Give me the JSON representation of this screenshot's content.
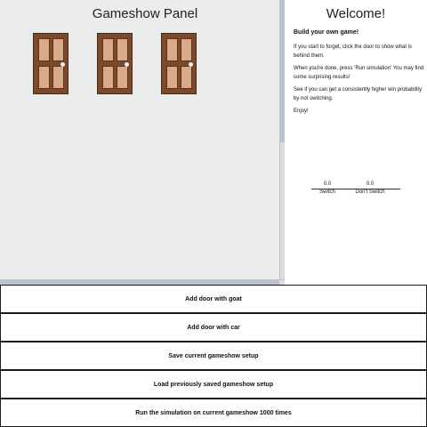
{
  "gameshow": {
    "title": "Gameshow Panel",
    "doors": [
      {
        "name": "door-1"
      },
      {
        "name": "door-2"
      },
      {
        "name": "door-3"
      }
    ]
  },
  "info": {
    "title": "Welcome!",
    "subtitle": "Build your own game!",
    "paragraphs": [
      "If you start to forget, click the door to show what is behind them.",
      "When you're done, press 'Run simulation' You may find some surprising results!",
      "See if you can get a consistently higher win probability by not switching.",
      "Enjoy!"
    ]
  },
  "stats": {
    "switch_value": "0.0",
    "noswitch_value": "0.0",
    "switch_label": "Switch",
    "noswitch_label": "Don't Switch"
  },
  "buttons": {
    "add_goat": "Add door with goat",
    "add_car": "Add door with car",
    "save": "Save current gameshow setup",
    "load": "Load previously saved gameshow setup",
    "run": "Run the simulation on current gameshow 1000 times"
  },
  "colors": {
    "door_frame": "#7a4a2a",
    "door_panel": "#d9a98a",
    "panel_background": "#ececec"
  }
}
